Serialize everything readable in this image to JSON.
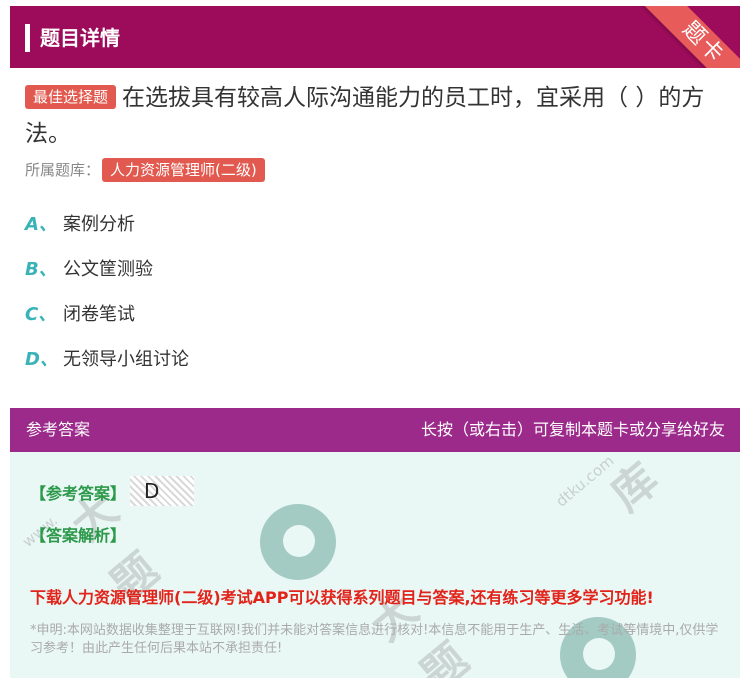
{
  "header": {
    "title": "题目详情",
    "ribbon": "题卡"
  },
  "question": {
    "tag": "最佳选择题",
    "text": "在选拔具有较高人际沟通能力的员工时，宜采用（ ）的方法。",
    "bank_label": "所属题库：",
    "bank_name": "人力资源管理师(二级)"
  },
  "options": [
    {
      "letter": "A、",
      "text": "案例分析"
    },
    {
      "letter": "B、",
      "text": "公文筐测验"
    },
    {
      "letter": "C、",
      "text": "闭卷笔试"
    },
    {
      "letter": "D、",
      "text": "无领导小组讨论"
    }
  ],
  "answer_section": {
    "title": "参考答案",
    "hint": "长按（或右击）可复制本题卡或分享给好友",
    "answer_label": "【参考答案】",
    "answer_value": "D",
    "analysis_label": "【答案解析】",
    "promo": "下载人力资源管理师(二级)考试APP可以获得系列题目与答案,还有练习等更多学习功能!",
    "disclaimer": "*申明:本网站数据收集整理于互联网!我们并未能对答案信息进行核对!本信息不能用于生产、生活、考试等情境中,仅供学习参考！由此产生任何后果本站不承担责任!"
  },
  "colors": {
    "header": "#9c0c5b",
    "tag": "#e25a4f",
    "letters": "#3ab3b8",
    "answer_bar": "#9c2a8b",
    "answer_bg": "#e9f7f5",
    "promo": "#e2231a"
  }
}
